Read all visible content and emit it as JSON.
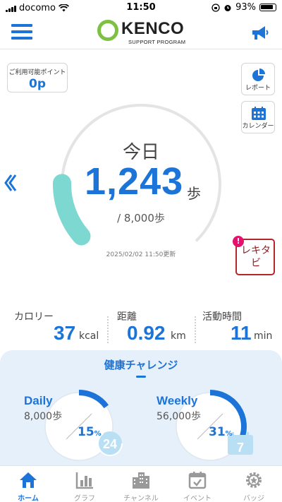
{
  "status_bar": {
    "carrier": "docomo",
    "time": "11:50",
    "battery": "93%"
  },
  "header": {
    "logo_name": "KENCO",
    "logo_sub": "SUPPORT PROGRAM"
  },
  "points": {
    "label": "ご利用可能ポイント",
    "value": "0p"
  },
  "side_buttons": {
    "report": "レポート",
    "calendar": "カレンダー"
  },
  "today": {
    "label": "今日",
    "steps": "1,243",
    "steps_unit": "歩",
    "goal": "/ 8,000歩",
    "updated": "2025/02/02 11:50更新",
    "progress": 0.155
  },
  "rekitabi": {
    "text": "レキタビ",
    "badge": "!"
  },
  "metrics": {
    "calorie": {
      "label": "カロリー",
      "value": "37",
      "unit": "kcal"
    },
    "distance": {
      "label": "距離",
      "value": "0.92",
      "unit": "km"
    },
    "activity": {
      "label": "活動時間",
      "value": "11",
      "unit": "min"
    }
  },
  "challenge": {
    "title": "健康チャレンジ",
    "daily": {
      "label": "Daily",
      "goal": "8,000歩",
      "pct": "15",
      "pct_unit": "%",
      "badge": "24",
      "progress": 0.15
    },
    "weekly": {
      "label": "Weekly",
      "goal": "56,000歩",
      "pct": "31",
      "pct_unit": "%",
      "badge": "7",
      "progress": 0.31
    }
  },
  "tabs": [
    {
      "label": "ホーム",
      "icon": "home-icon",
      "active": true
    },
    {
      "label": "グラフ",
      "icon": "bar-chart-icon",
      "active": false
    },
    {
      "label": "チャンネル",
      "icon": "building-icon",
      "active": false
    },
    {
      "label": "イベント",
      "icon": "event-calendar-icon",
      "active": false
    },
    {
      "label": "バッジ",
      "icon": "badge-gear-icon",
      "active": false
    }
  ],
  "colors": {
    "accent": "#1c73d8",
    "gauge": "#7dd8d2",
    "logo_green": "#7cc142",
    "rekitabi_red": "#b3262b"
  }
}
